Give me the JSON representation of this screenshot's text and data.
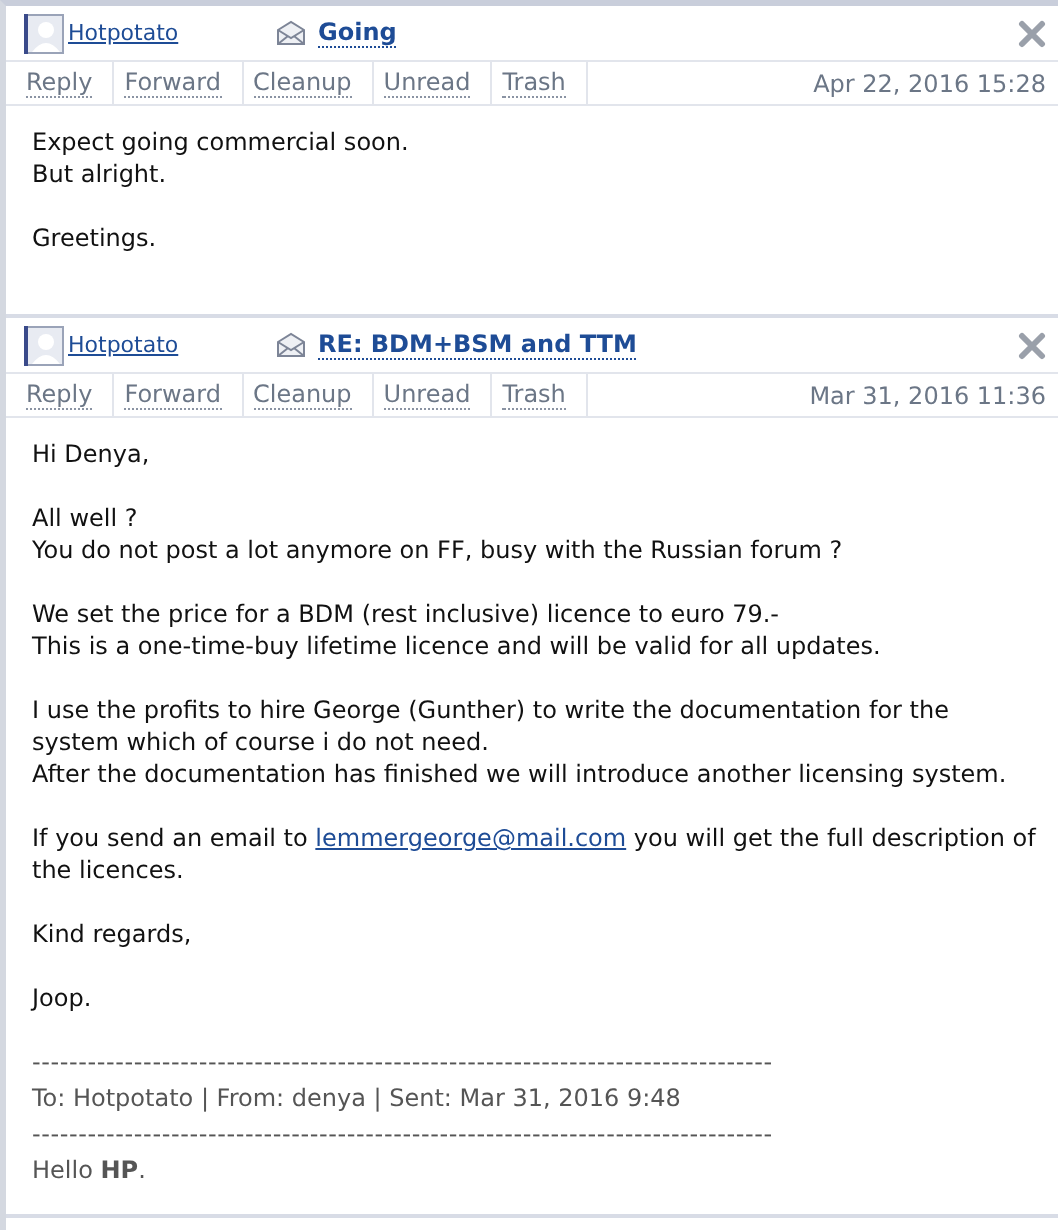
{
  "messages": [
    {
      "sender": "Hotpotato",
      "subject": "Going",
      "actions": [
        "Reply",
        "Forward",
        "Cleanup",
        "Unread",
        "Trash"
      ],
      "date": "Apr 22, 2016 15:28",
      "body": [
        {
          "kind": "text",
          "lines": [
            "Expect going commercial soon.",
            "But alright."
          ]
        },
        {
          "kind": "text",
          "lines": [
            "Greetings."
          ]
        }
      ]
    },
    {
      "sender": "Hotpotato",
      "subject": "RE: BDM+BSM and TTM",
      "actions": [
        "Reply",
        "Forward",
        "Cleanup",
        "Unread",
        "Trash"
      ],
      "date": "Mar 31, 2016 11:36",
      "body": [
        {
          "kind": "text",
          "lines": [
            "Hi Denya,"
          ]
        },
        {
          "kind": "text",
          "lines": [
            "All well ?",
            "You do not post a lot anymore on FF, busy with the Russian forum ?"
          ]
        },
        {
          "kind": "text",
          "lines": [
            "We set the price for a BDM (rest inclusive) licence to euro 79.-",
            "This is a one-time-buy lifetime licence and will be valid for all updates."
          ]
        },
        {
          "kind": "text",
          "lines": [
            "I use the profits to hire George (Gunther) to write the documentation for the",
            "system which of course i do not need.",
            "After the documentation has finished we will introduce another licensing system."
          ]
        },
        {
          "kind": "link",
          "before": "If you send an email to",
          "link": "lemmergeorge@mail.com",
          "after": "you will get the full description of the licences."
        },
        {
          "kind": "text",
          "lines": [
            "Kind regards,"
          ]
        },
        {
          "kind": "text",
          "lines": [
            "Joop."
          ]
        },
        {
          "kind": "quote",
          "rule": "--------------------------------------------------------------------------------",
          "meta": "To: Hotpotato | From: denya | Sent: Mar 31, 2016 9:48"
        },
        {
          "kind": "rich",
          "text": "Hello **HP**."
        }
      ]
    }
  ]
}
